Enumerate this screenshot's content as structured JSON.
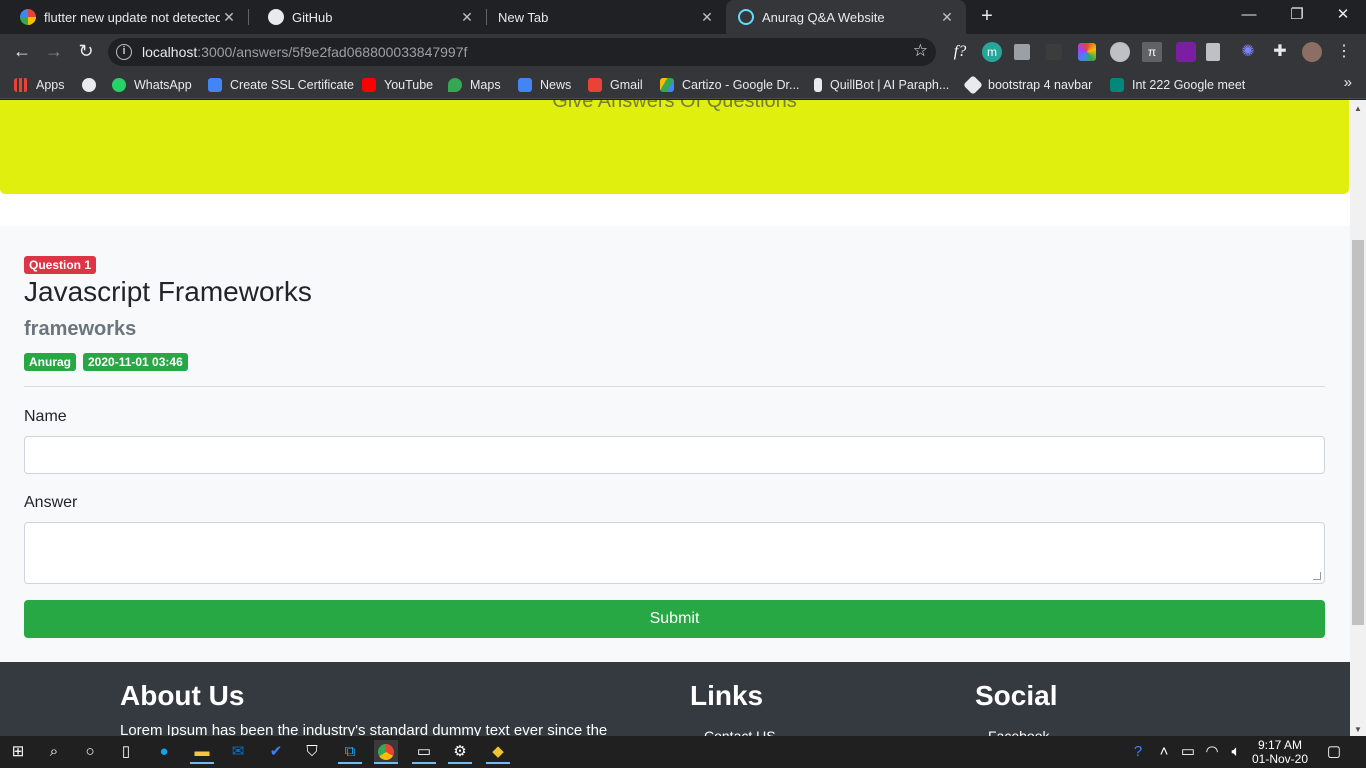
{
  "tabs": [
    {
      "title": "flutter new update not detected",
      "favicon": "google-icon"
    },
    {
      "title": "GitHub",
      "favicon": "github-icon"
    },
    {
      "title": "New Tab",
      "favicon": ""
    },
    {
      "title": "Anurag Q&A Website",
      "favicon": "react-icon",
      "active": true
    }
  ],
  "new_tab_label": "+",
  "window_controls": {
    "minimize": "—",
    "restore": "❐",
    "close": "✕"
  },
  "address": {
    "host": "localhost",
    "path": ":3000/answers/5f9e2fad068800033847997f"
  },
  "bookmarks": [
    {
      "label": "Apps",
      "icon": "apps-grid-icon",
      "color": "#ea4335"
    },
    {
      "label": "",
      "icon": "globe-icon",
      "color": "#e8eaed"
    },
    {
      "label": "WhatsApp",
      "icon": "whatsapp-icon",
      "color": "#25d366"
    },
    {
      "label": "Create SSL Certificate",
      "icon": "puzzle-icon",
      "color": "#4285f4"
    },
    {
      "label": "YouTube",
      "icon": "youtube-icon",
      "color": "#ff0000"
    },
    {
      "label": "Maps",
      "icon": "maps-pin-icon",
      "color": "#34a853"
    },
    {
      "label": "News",
      "icon": "news-icon",
      "color": "#4285f4"
    },
    {
      "label": "Gmail",
      "icon": "gmail-icon",
      "color": "#ea4335"
    },
    {
      "label": "Cartizo - Google Dr...",
      "icon": "drive-icon",
      "color": "#fbbc04"
    },
    {
      "label": "QuillBot | AI Paraph...",
      "icon": "quill-icon",
      "color": "#e8eaed"
    },
    {
      "label": "bootstrap 4 navbar",
      "icon": "codepen-icon",
      "color": "#e8eaed"
    },
    {
      "label": "Int 222 Google meet",
      "icon": "meet-icon",
      "color": "#00897b"
    }
  ],
  "bookmarks_more": "»",
  "jumbotron": {
    "lead": "Give Answers Of Questions",
    "color": "#e1ef0f"
  },
  "question": {
    "badge": "Question 1",
    "title": "Javascript Frameworks",
    "subtitle": "frameworks",
    "author": "Anurag",
    "date": "2020-11-01 03:46"
  },
  "form": {
    "name_label": "Name",
    "name_value": "",
    "answer_label": "Answer",
    "answer_value": "",
    "submit_label": "Submit"
  },
  "footer": {
    "about_title": "About Us",
    "about_text": "Lorem Ipsum has been the industry's standard dummy text ever since the",
    "links_title": "Links",
    "links_first": "Contact US",
    "social_title": "Social",
    "social_first": "Facebook"
  },
  "taskbar": {
    "time": "9:17 AM",
    "date": "01-Nov-20"
  },
  "colors": {
    "success": "#28a745",
    "danger": "#dc3545",
    "footer": "#343a40"
  }
}
